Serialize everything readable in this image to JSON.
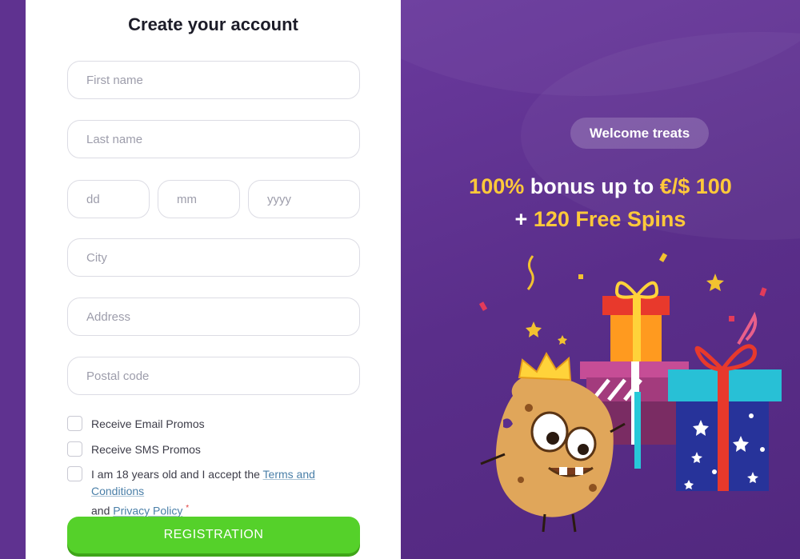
{
  "form": {
    "title": "Create your account",
    "fields": {
      "first_name": "First name",
      "last_name": "Last name",
      "day": "dd",
      "month": "mm",
      "year": "yyyy",
      "city": "City",
      "address": "Address",
      "postal_code": "Postal code"
    },
    "checks": {
      "email_promos": "Receive Email Promos",
      "sms_promos": "Receive SMS Promos",
      "age_prefix": "I am 18 years old and I accept the",
      "terms_link": "Terms and Conditions",
      "and_text": "and",
      "privacy_link": "Privacy Policy",
      "required_mark": "*"
    },
    "submit_label": "REGISTRATION"
  },
  "promo": {
    "badge": "Welcome treats",
    "line1_pct": "100%",
    "line1_mid": "bonus up to",
    "line1_amount": "€/$ 100",
    "line2_plus": "+",
    "line2_spins": "120 Free Spins"
  },
  "colors": {
    "background_purple": "#5b2f8c",
    "highlight_yellow": "#ffc93a",
    "button_green": "#55d12a",
    "link_blue": "#4a7fa8"
  }
}
